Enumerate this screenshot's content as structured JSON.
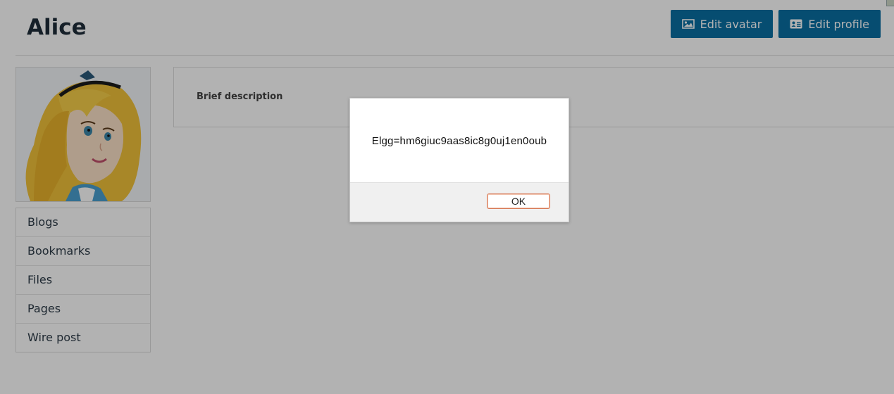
{
  "profile": {
    "name": "Alice",
    "edit_avatar_label": "Edit avatar",
    "edit_profile_label": "Edit profile",
    "brief_description_label": "Brief description"
  },
  "owner_menu": [
    {
      "label": "Blogs"
    },
    {
      "label": "Bookmarks"
    },
    {
      "label": "Files"
    },
    {
      "label": "Pages"
    },
    {
      "label": "Wire post"
    }
  ],
  "alert": {
    "message": "Elgg=hm6giuc9aas8ic8g0uj1en0oub",
    "ok_label": "OK"
  },
  "colors": {
    "primary_button": "#0a6fa3",
    "overlay": "rgba(0,0,0,0.3)"
  },
  "icons": {
    "edit_avatar": "image-icon",
    "edit_profile": "id-card-icon"
  }
}
